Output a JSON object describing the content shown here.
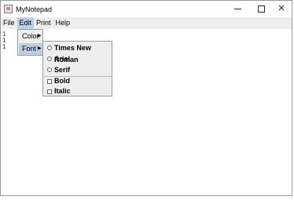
{
  "window": {
    "title": "MyNotepad"
  },
  "menubar": {
    "file": "File",
    "edit": "Edit",
    "print": "Print",
    "help": "Help"
  },
  "editor": {
    "lines": [
      "1",
      "1",
      "1"
    ]
  },
  "edit_menu": {
    "color": "Color",
    "font": "Font"
  },
  "font_menu": {
    "times": "Times New Roman",
    "arial": "Arial",
    "serif": "Serif",
    "bold": "Bold",
    "italic": "Italic"
  },
  "colors": {
    "highlight": "#b8cfe5",
    "menubar": "#eeeeee",
    "line_numbers": "#b00000"
  }
}
